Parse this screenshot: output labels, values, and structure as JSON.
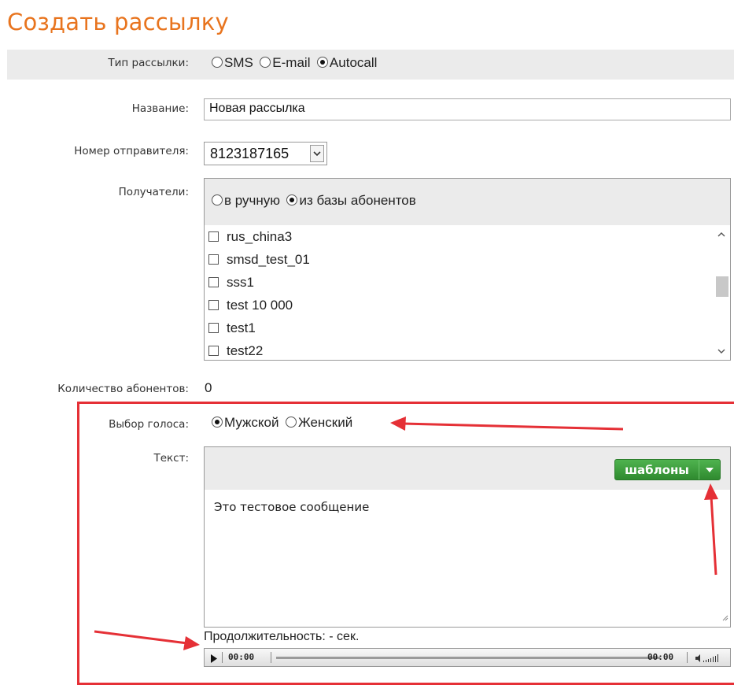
{
  "page": {
    "title": "Создать рассылку"
  },
  "form": {
    "type": {
      "label": "Тип рассылки:",
      "options": [
        "SMS",
        "E-mail",
        "Autocall"
      ],
      "selected": "Autocall"
    },
    "name": {
      "label": "Название:",
      "value": "Новая рассылка"
    },
    "sender": {
      "label": "Номер отправителя:",
      "value": "8123187165"
    },
    "recipients": {
      "label": "Получатели:",
      "modes": [
        "в ручную",
        "из базы абонентов"
      ],
      "selected_mode": "из базы абонентов",
      "items": [
        "rus_china3",
        "smsd_test_01",
        "sss1",
        "test 10 000",
        "test1",
        "test22"
      ]
    },
    "count": {
      "label": "Количество абонентов:",
      "value": "0"
    },
    "voice": {
      "label": "Выбор голоса:",
      "options": [
        "Мужской",
        "Женский"
      ],
      "selected": "Мужской"
    },
    "text": {
      "label": "Текст:",
      "templates_button": "шаблоны",
      "message": "Это тестовое сообщение"
    },
    "duration": "Продолжительность: - сек.",
    "player": {
      "current_time": "00:00",
      "total_time": "00:00"
    }
  },
  "colors": {
    "title": "#e8741e",
    "annotation_red": "#e53036",
    "button_green": "#3c9e3c"
  }
}
